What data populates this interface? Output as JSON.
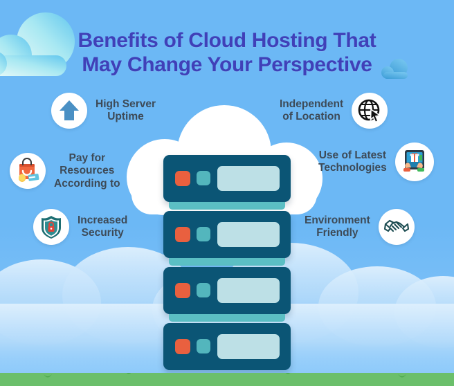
{
  "title": {
    "line1": "Benefits of Cloud Hosting That",
    "line2": "May Change Your Perspective"
  },
  "benefits_left": [
    {
      "id": "uptime",
      "label": "High Server\nUptime",
      "icon": "up-arrow-icon"
    },
    {
      "id": "pay",
      "label": "Pay for\nResources\nAccording to",
      "icon": "shopping-bag-icon"
    },
    {
      "id": "security",
      "label": "Increased\nSecurity",
      "icon": "shield-lock-icon"
    }
  ],
  "benefits_right": [
    {
      "id": "location",
      "label": "Independent\nof Location",
      "icon": "globe-cursor-icon"
    },
    {
      "id": "technologies",
      "label": "Use of Latest\nTechnologies",
      "icon": "tablet-gift-icon"
    },
    {
      "id": "environment",
      "label": "Environment\nFriendly",
      "icon": "handshake-icon"
    }
  ],
  "server_stack": {
    "name": "server-rack",
    "units": 4,
    "unit_indicator_red": "#e9603f",
    "unit_indicator_teal": "#53b6bd",
    "unit_body_color": "#0b5575",
    "unit_panel_color": "#bde0e6",
    "unit_foot_color": "#5bbfc4"
  },
  "scene": {
    "sky_color": "#6cb8f5",
    "grass_color": "#6bbf6b",
    "cloud_color": "#ffffff",
    "title_color": "#4040b8",
    "label_color": "#3d4a57"
  }
}
